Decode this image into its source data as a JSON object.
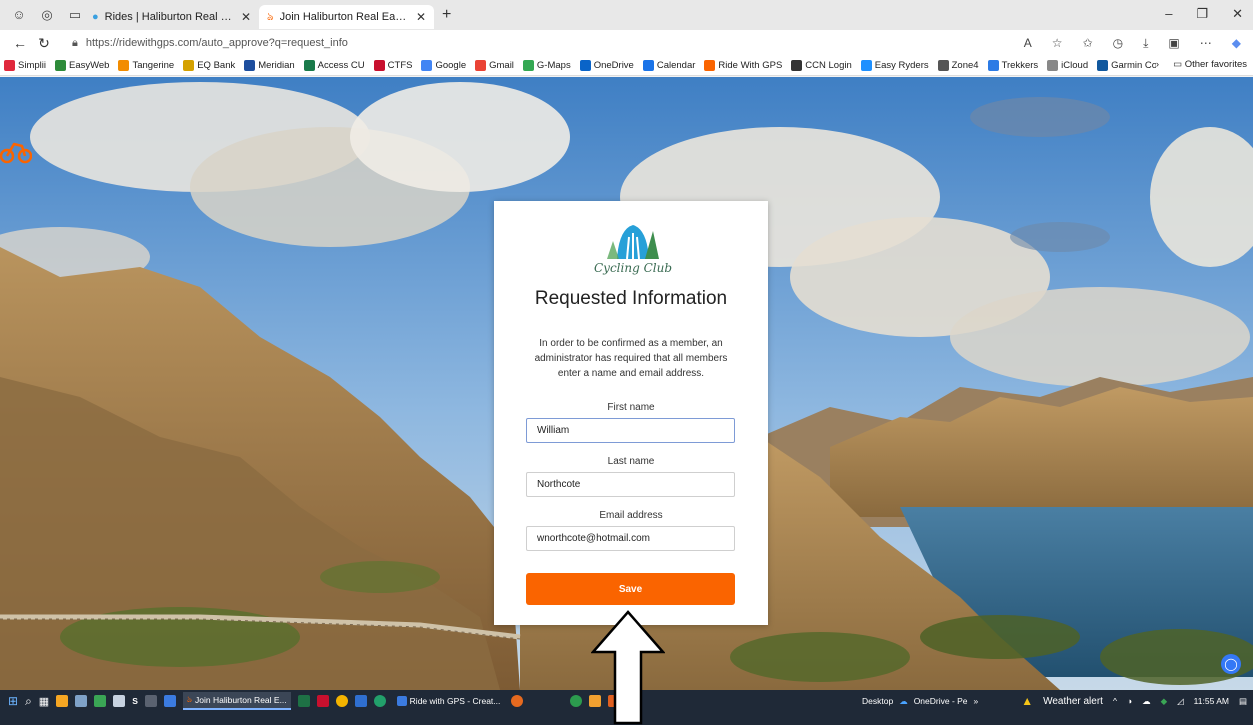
{
  "browser": {
    "tabs": [
      {
        "title": "Rides | Haliburton Real Easy Ryde",
        "active": false
      },
      {
        "title": "Join Haliburton Real Easy Ryders",
        "active": true
      }
    ],
    "url": "https://ridewithgps.com/auto_approve?q=request_info",
    "bookmarks": [
      {
        "label": "Simplii",
        "color": "#e0283c"
      },
      {
        "label": "EasyWeb",
        "color": "#2e8b3a"
      },
      {
        "label": "Tangerine",
        "color": "#f28c00"
      },
      {
        "label": "EQ Bank",
        "color": "#d4a100"
      },
      {
        "label": "Meridian",
        "color": "#1d4e9e"
      },
      {
        "label": "Access CU",
        "color": "#1a7a4a"
      },
      {
        "label": "CTFS",
        "color": "#c8102e"
      },
      {
        "label": "Google",
        "color": "#4285f4"
      },
      {
        "label": "Gmail",
        "color": "#ea4335"
      },
      {
        "label": "G-Maps",
        "color": "#34a853"
      },
      {
        "label": "OneDrive",
        "color": "#0a64c8"
      },
      {
        "label": "Calendar",
        "color": "#1a73e8"
      },
      {
        "label": "Ride With GPS",
        "color": "#fa6400"
      },
      {
        "label": "CCN Login",
        "color": "#333333"
      },
      {
        "label": "Easy Ryders",
        "color": "#1e90ff"
      },
      {
        "label": "Zone4",
        "color": "#555555"
      },
      {
        "label": "Trekkers",
        "color": "#2c7be5"
      },
      {
        "label": "iCloud",
        "color": "#888888"
      },
      {
        "label": "Garmin Connect",
        "color": "#11589e"
      }
    ],
    "other_favorites": "Other favorites"
  },
  "card": {
    "logo_text": "Cycling Club",
    "title": "Requested Information",
    "description": "In order to be confirmed as a member, an administrator has required that all members enter a name and email address.",
    "first_name_label": "First name",
    "first_name_value": "William",
    "last_name_label": "Last name",
    "last_name_value": "Northcote",
    "email_label": "Email address",
    "email_value": "wnorthcote@hotmail.com",
    "save_label": "Save"
  },
  "taskbar": {
    "apps": [
      {
        "label": "Join Haliburton Real E..."
      },
      {
        "label": "Ride with GPS - Creat..."
      }
    ],
    "desktop_label": "Desktop",
    "onedrive_label": "OneDrive - Pe",
    "weather_label": "Weather alert",
    "time": "11:55 AM"
  },
  "colors": {
    "accent": "#fa6400",
    "taskbar": "#1f2937"
  }
}
